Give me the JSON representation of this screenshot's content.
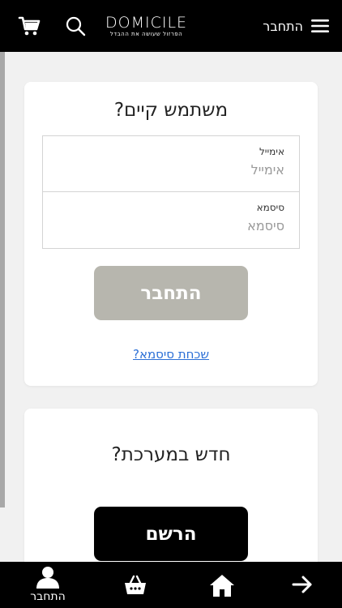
{
  "header": {
    "logo_text": "DOMICILE",
    "logo_tagline": "הפרזול שעושה את ההבדל",
    "login_text": "התחבר"
  },
  "login_card": {
    "title": "משתמש קיים?",
    "email": {
      "label": "אימייל",
      "placeholder": "אימייל",
      "value": ""
    },
    "password": {
      "label": "סיסמא",
      "placeholder": "סיסמא",
      "value": ""
    },
    "login_button": "התחבר",
    "forgot_link": "שכחת סיסמא?"
  },
  "register_card": {
    "title": "חדש במערכת?",
    "register_button": "הרשם"
  },
  "bottom_nav": {
    "user_label": "התחבר",
    "icons": [
      "user-icon",
      "basket-icon",
      "home-icon",
      "arrow-right-icon"
    ]
  },
  "colors": {
    "header_bg": "#000000",
    "login_button_bg": "#b7b6ae",
    "register_button_bg": "#000000",
    "link": "#2b6fd6",
    "page_bg": "#f1f1f1"
  }
}
